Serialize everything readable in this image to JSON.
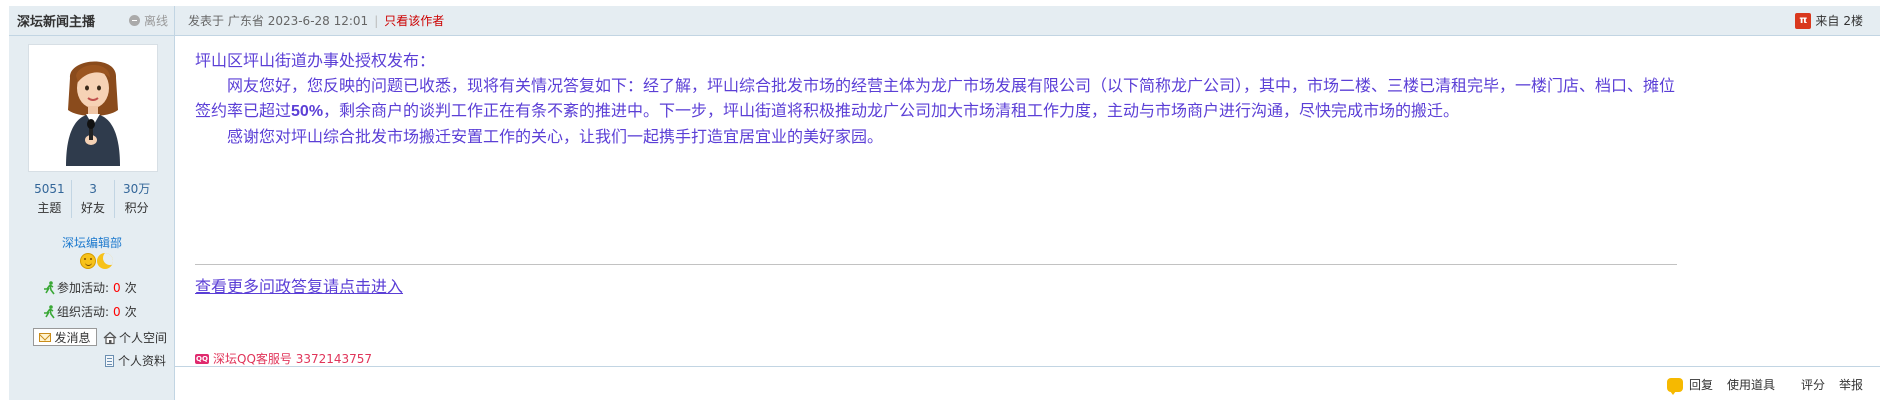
{
  "author": {
    "name": "深坛新闻主播",
    "status": "离线",
    "stats": [
      {
        "value": "5051",
        "label": "主题"
      },
      {
        "value": "3",
        "label": "好友"
      },
      {
        "value": "30万",
        "label": "积分"
      }
    ],
    "group": "深坛编辑部",
    "activities": [
      {
        "label": "参加活动:",
        "count": "0",
        "unit": "次"
      },
      {
        "label": "组织活动:",
        "count": "0",
        "unit": "次"
      }
    ],
    "links": {
      "message": "发消息",
      "space": "个人空间",
      "profile": "个人资料"
    }
  },
  "post": {
    "meta": {
      "posted_prefix": "发表于",
      "location": "广东省",
      "datetime": "2023-6-28 12:01",
      "only_author": "只看该作者"
    },
    "floor": {
      "source_label": "来自",
      "floor_label": "2楼"
    },
    "content": {
      "heading": "坪山区坪山街道办事处授权发布：",
      "para1_before": "网友您好，您反映的问题已收悉，现将有关情况答复如下：经了解，坪山综合批发市场的经营主体为龙广市场发展有限公司（以下简称龙广公司），其中，市场二楼、三楼已清租完毕，一楼门店、档口、摊位签约率已超过",
      "para1_highlight": "50%",
      "para1_after": "，剩余商户的谈判工作正在有条不紊的推进中。下一步，坪山街道将积极推动龙广公司加大市场清租工作力度，主动与市场商户进行沟通，尽快完成市场的搬迁。",
      "para2": "感谢您对坪山综合批发市场搬迁安置工作的关心，让我们一起携手打造宜居宜业的美好家园。"
    },
    "more_link": "查看更多问政答复请点击进入",
    "qq_service": "深坛QQ客服号 3372143757",
    "qq_icon_text": "QQ",
    "phone_icon_text": "π"
  },
  "actions": {
    "reply": "回复",
    "tools": "使用道具",
    "rate": "评分",
    "report": "举报"
  },
  "colors": {
    "header_bg": "#e5edf2",
    "border": "#c2d5e3",
    "content_text": "#5b3fd6",
    "alert_red": "#cc0000"
  }
}
